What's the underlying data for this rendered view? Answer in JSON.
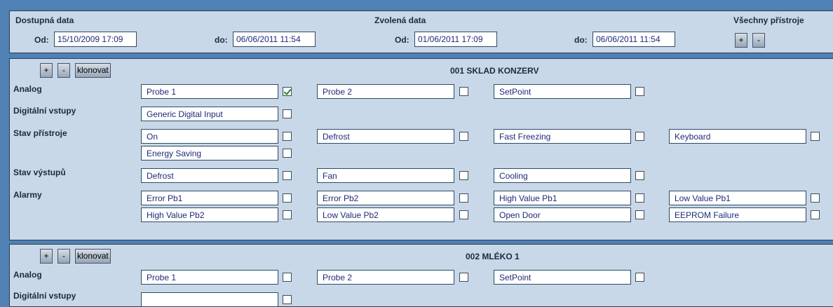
{
  "filter": {
    "available_label": "Dostupná data",
    "selected_label": "Zvolená data",
    "all_devices_label": "Všechny přístroje",
    "from_label": "Od:",
    "to_label": "do:",
    "available_from": "15/10/2009 17:09",
    "available_to": "06/06/2011 11:54",
    "selected_from": "01/06/2011 17:09",
    "selected_to": "06/06/2011 11:54",
    "plus": "+",
    "minus": "-"
  },
  "device_buttons": {
    "plus": "+",
    "minus": "-",
    "clone": "klonovat"
  },
  "section_labels": {
    "analog": "Analog",
    "digital": "Digitální vstupy",
    "device_state": "Stav přístroje",
    "output_state": "Stav výstupů",
    "alarms": "Alarmy"
  },
  "devices": [
    {
      "title": "001 SKLAD KONZERV",
      "analog": [
        "Probe 1",
        "Probe 2",
        "SetPoint"
      ],
      "analog_checked": [
        true,
        false,
        false
      ],
      "digital": [
        "Generic Digital Input"
      ],
      "device_state": [
        "On",
        "Defrost",
        "Fast Freezing",
        "Keyboard",
        "Energy Saving"
      ],
      "output_state": [
        "Defrost",
        "Fan",
        "Cooling"
      ],
      "alarms": [
        "Error Pb1",
        "Error Pb2",
        "High Value Pb1",
        "Low Value Pb1",
        "High Value Pb2",
        "Low Value Pb2",
        "Open Door",
        "EEPROM Failure"
      ]
    },
    {
      "title": "002 MLÉKO 1",
      "analog": [
        "Probe 1",
        "Probe 2",
        "SetPoint"
      ],
      "analog_checked": [
        false,
        false,
        false
      ]
    }
  ]
}
